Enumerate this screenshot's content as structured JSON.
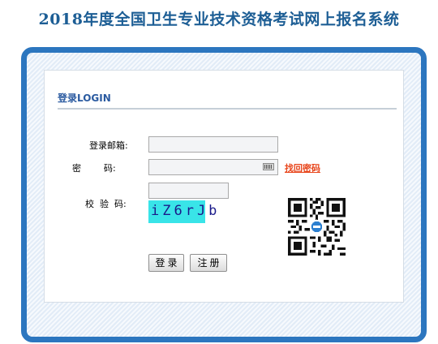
{
  "page": {
    "title": "2018年度全国卫生专业技术资格考试网上报名系统"
  },
  "login": {
    "heading": "登录LOGIN",
    "email_label": "登录邮箱:",
    "email_value": "",
    "password_label": "密        码:",
    "password_value": "",
    "forgot_link": "找回密码",
    "captcha_label": "校  验  码:",
    "captcha_value": "",
    "captcha_text": "iZ6rJb",
    "login_button": "登录",
    "register_button": "注册"
  },
  "colors": {
    "title": "#1d5e95",
    "frame_border": "#2c76bf",
    "link": "#e8461c",
    "captcha_bg": "#39e4e8"
  },
  "icons": {
    "keyboard": "keyboard-icon",
    "qr": "qr-code"
  }
}
